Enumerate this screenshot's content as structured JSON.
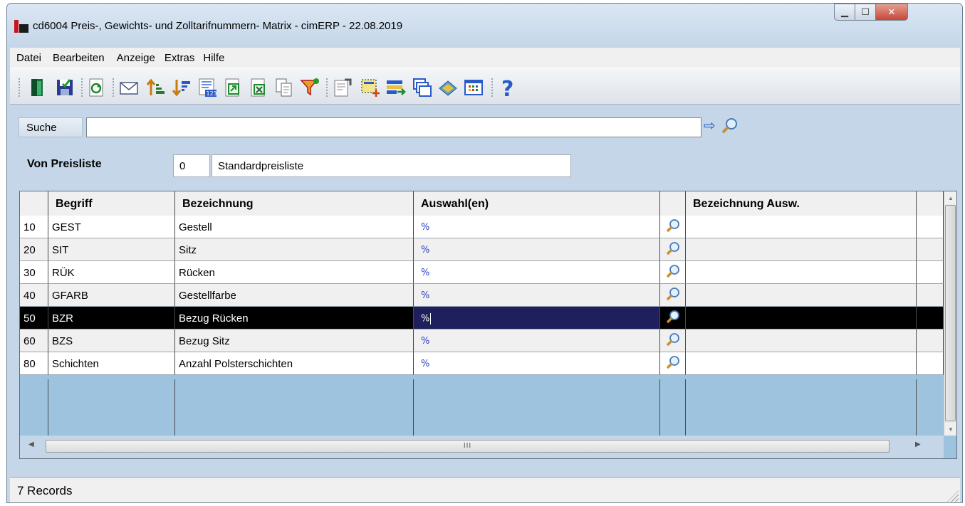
{
  "window": {
    "title": "cd6004 Preis-, Gewichts- und Zolltarifnummern- Matrix - cimERP - 22.08.2019"
  },
  "menu": [
    "Datei",
    "Bearbeiten",
    "Anzeige",
    "Extras",
    "Hilfe"
  ],
  "toolbar_icons": [
    "exit-door-icon",
    "save-icon",
    "refresh-icon",
    "mail-icon",
    "sort-ascending-icon",
    "sort-descending-icon",
    "number-format-icon",
    "export-icon",
    "excel-export-icon",
    "copy-icon",
    "filter-icon",
    "properties-icon",
    "select-area-icon",
    "list-arrow-icon",
    "windows-icon",
    "book-icon",
    "grid-view-icon",
    "help-icon"
  ],
  "search": {
    "label": "Suche",
    "value": ""
  },
  "preisliste": {
    "label": "Von Preisliste",
    "code": "0",
    "name": "Standardpreisliste"
  },
  "table": {
    "columns": [
      "Begriff",
      "Bezeichnung",
      "Auswahl(en)",
      "",
      "Bezeichnung Ausw."
    ],
    "rows": [
      {
        "nr": "10",
        "begriff": "GEST",
        "bezeichnung": "Gestell",
        "auswahl": "%",
        "bez_ausw": ""
      },
      {
        "nr": "20",
        "begriff": "SIT",
        "bezeichnung": "Sitz",
        "auswahl": "%",
        "bez_ausw": ""
      },
      {
        "nr": "30",
        "begriff": "RÜK",
        "bezeichnung": "Rücken",
        "auswahl": "%",
        "bez_ausw": ""
      },
      {
        "nr": "40",
        "begriff": "GFARB",
        "bezeichnung": "Gestellfarbe",
        "auswahl": "%",
        "bez_ausw": ""
      },
      {
        "nr": "50",
        "begriff": "BZR",
        "bezeichnung": "Bezug Rücken",
        "auswahl": "%",
        "bez_ausw": ""
      },
      {
        "nr": "60",
        "begriff": "BZS",
        "bezeichnung": "Bezug Sitz",
        "auswahl": "%",
        "bez_ausw": ""
      },
      {
        "nr": "80",
        "begriff": "Schichten",
        "bezeichnung": "Anzahl Polsterschichten",
        "auswahl": "%",
        "bez_ausw": ""
      }
    ],
    "selected_row": 4,
    "hscroll_glyph": "III"
  },
  "status": {
    "records": "7 Records"
  }
}
